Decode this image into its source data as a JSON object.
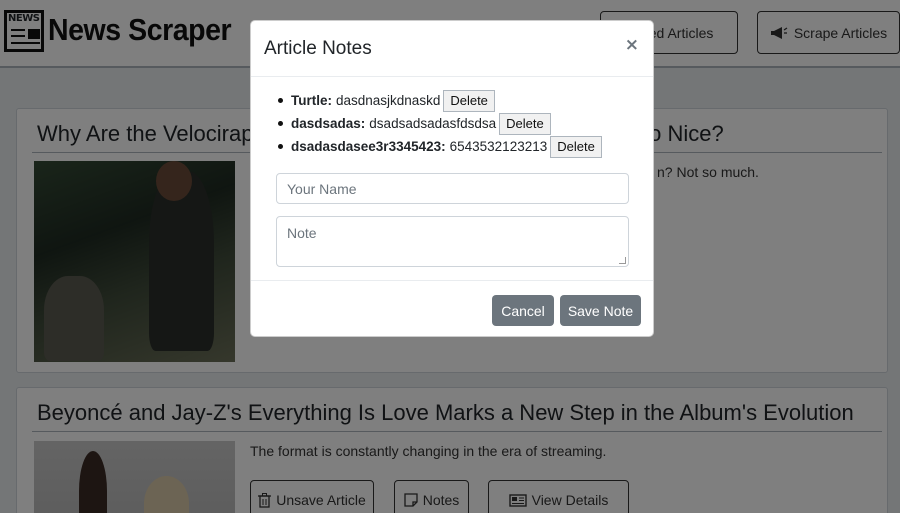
{
  "header": {
    "brand": "News Scraper",
    "logo_text": "NEWS",
    "saved_label": "Saved Articles",
    "scrape_label": "Scrape Articles"
  },
  "articles": [
    {
      "title": "Why Are the Velociraptors in Jurassic World: Fallen Kingdom So Nice?",
      "summary": "n? Not so much."
    },
    {
      "title": "Beyoncé and Jay-Z's Everything Is Love Marks a New Step in the Album's Evolution",
      "summary": "The format is constantly changing in the era of streaming.",
      "unsave_label": "Unsave Article",
      "notes_label": "Notes",
      "details_label": "View Details"
    }
  ],
  "modal": {
    "title": "Article Notes",
    "close": "×",
    "notes": [
      {
        "name": "Turtle:",
        "text": "dasdnasjkdnaskd",
        "delete": "Delete"
      },
      {
        "name": "dasdsadas:",
        "text": "dsadsadsadasfdsdsa",
        "delete": "Delete"
      },
      {
        "name": "dsadasdasee3r3345423:",
        "text": "6543532123213",
        "delete": "Delete"
      }
    ],
    "name_placeholder": "Your Name",
    "note_placeholder": "Note",
    "cancel_label": "Cancel",
    "save_label": "Save Note"
  }
}
